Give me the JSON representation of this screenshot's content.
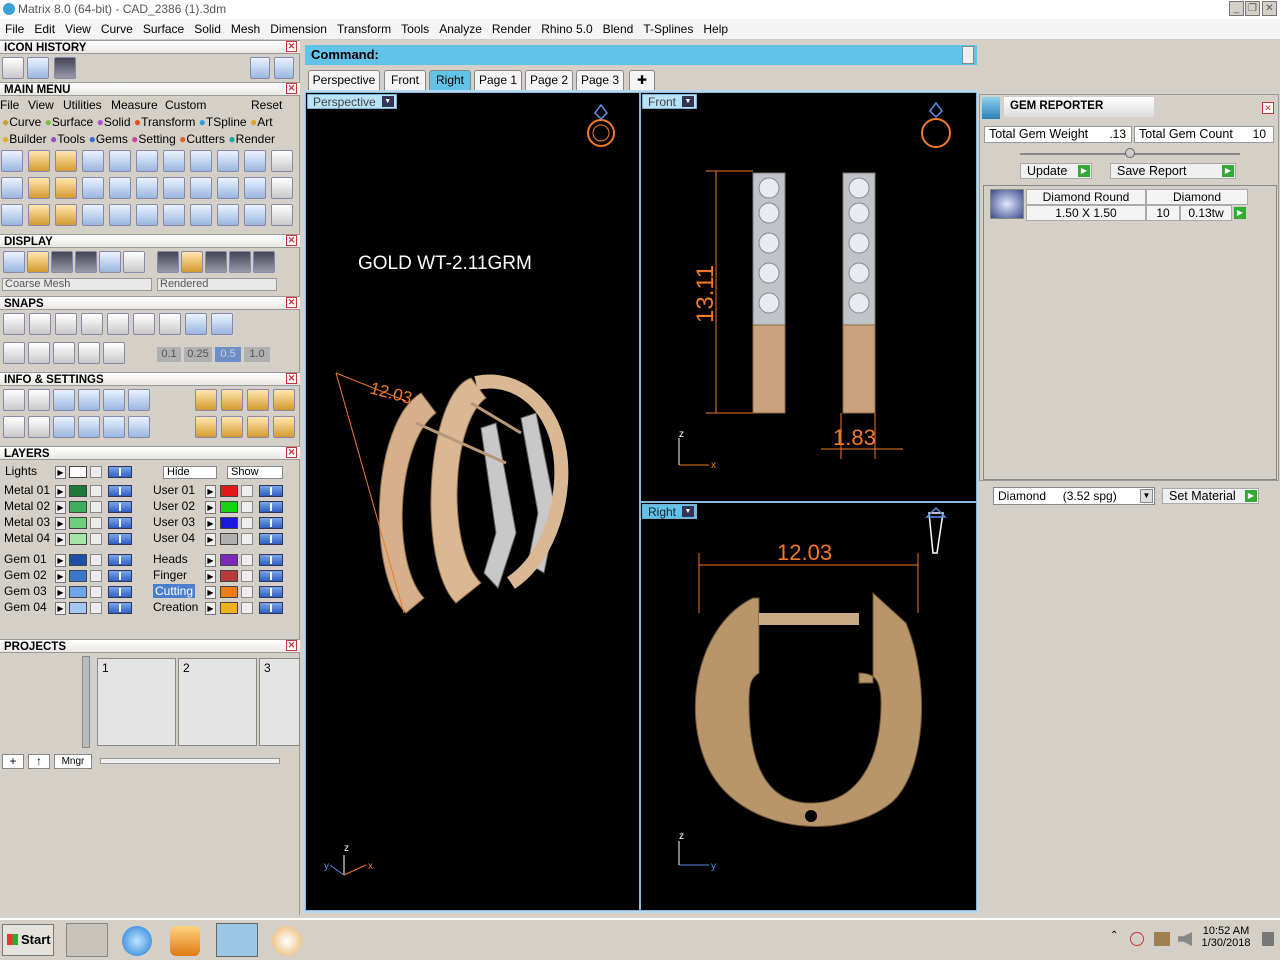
{
  "window": {
    "title": "Matrix 8.0 (64-bit) - CAD_2386 (1).3dm"
  },
  "menubar": [
    "File",
    "Edit",
    "View",
    "Curve",
    "Surface",
    "Solid",
    "Mesh",
    "Dimension",
    "Transform",
    "Tools",
    "Analyze",
    "Render",
    "Rhino 5.0",
    "Blend",
    "T-Splines",
    "Help"
  ],
  "left": {
    "icon_history": "ICON HISTORY",
    "main_menu": "MAIN MENU",
    "main_menu_items": [
      "File",
      "View",
      "Utilities",
      "Measure",
      "Custom",
      "Reset"
    ],
    "categories_row1": [
      "Curve",
      "Surface",
      "Solid",
      "Transform",
      "TSpline",
      "Art"
    ],
    "categories_row2": [
      "Builder",
      "Tools",
      "Gems",
      "Setting",
      "Cutters",
      "Render"
    ],
    "display": "DISPLAY",
    "display_mesh": "Coarse Mesh",
    "display_mode": "Rendered",
    "snaps": "SNAPS",
    "snap_values": [
      "0.1",
      "0.25",
      "0.5",
      "1.0"
    ],
    "info": "INFO & SETTINGS",
    "layers": "LAYERS",
    "lights": "Lights",
    "hide": "Hide",
    "show": "Show",
    "layers_left": [
      "Metal 01",
      "Metal 02",
      "Metal 03",
      "Metal 04",
      "Gem 01",
      "Gem 02",
      "Gem 03",
      "Gem 04"
    ],
    "layers_right": [
      "User 01",
      "User 02",
      "User 03",
      "User 04",
      "Heads",
      "Finger",
      "Cutting",
      "Creation"
    ],
    "projects": "PROJECTS",
    "project_slots": [
      "1",
      "2",
      "3"
    ],
    "mngr": "Mngr"
  },
  "layer_colors_left": [
    "#1b7a3a",
    "#3fae5c",
    "#6ccf7a",
    "#a6e6a8",
    "#1f4fa8",
    "#3a78cc",
    "#6fa4e8",
    "#a4c8f4"
  ],
  "layer_colors_right": [
    "#e31818",
    "#1ad11a",
    "#1818e0",
    "#b0b0b0",
    "#7a2ab8",
    "#b83a3a",
    "#f07a14",
    "#f0b020"
  ],
  "command": {
    "label": "Command:"
  },
  "tabs": [
    "Perspective",
    "Front",
    "Right",
    "Page 1",
    "Page 2",
    "Page 3"
  ],
  "viewports": {
    "perspective": {
      "label": "Perspective",
      "note": "GOLD WT-2.11GRM",
      "dim": "12.03"
    },
    "front": {
      "label": "Front",
      "dim_height": "13.11",
      "dim_width": "1.83"
    },
    "right": {
      "label": "Right",
      "dim": "12.03"
    }
  },
  "gem_reporter": {
    "title": "GEM REPORTER",
    "total_weight_label": "Total Gem Weight",
    "total_weight": ".13",
    "total_count_label": "Total Gem Count",
    "total_count": "10",
    "update": "Update",
    "save_report": "Save Report",
    "row": {
      "shape": "Diamond Round",
      "material": "Diamond",
      "size": "1.50 X 1.50",
      "count": "10",
      "weight": "0.13tw"
    },
    "material_select": "Diamond     (3.52 spg)",
    "set_material": "Set Material"
  },
  "taskbar": {
    "start": "Start",
    "time": "10:52 AM",
    "date": "1/30/2018"
  },
  "colors": {
    "accent": "#62c3e8",
    "dimension": "#f07a2a",
    "gold": "#c9a074"
  }
}
